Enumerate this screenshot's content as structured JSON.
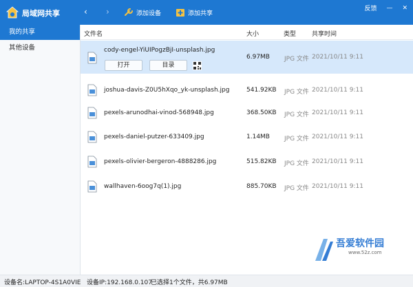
{
  "window": {
    "title": "局域网共享",
    "feedback_label": "反馈",
    "minimize_symbol": "—",
    "close_symbol": "✕",
    "accent_color": "#1e78d2"
  },
  "toolbar": {
    "back_icon": "‹",
    "forward_icon": "›",
    "add_device_label": "添加设备",
    "add_share_label": "添加共享"
  },
  "sidebar": {
    "items": [
      {
        "label": "我的共享",
        "active": true
      },
      {
        "label": "其他设备",
        "active": false
      }
    ]
  },
  "table": {
    "headers": {
      "name": "文件名",
      "size": "大小",
      "type": "类型",
      "time": "共享时间"
    },
    "rows": [
      {
        "name": "cody-engel-YiUIPogzBjI-unsplash.jpg",
        "size": "6.97MB",
        "type": "JPG 文件",
        "time": "2021/10/11 9:11",
        "selected": true
      },
      {
        "name": "joshua-davis-Z0U5hXqo_yk-unsplash.jpg",
        "size": "541.92KB",
        "type": "JPG 文件",
        "time": "2021/10/11 9:11",
        "selected": false
      },
      {
        "name": "pexels-arunodhai-vinod-568948.jpg",
        "size": "368.50KB",
        "type": "JPG 文件",
        "time": "2021/10/11 9:11",
        "selected": false
      },
      {
        "name": "pexels-daniel-putzer-633409.jpg",
        "size": "1.14MB",
        "type": "JPG 文件",
        "time": "2021/10/11 9:11",
        "selected": false
      },
      {
        "name": "pexels-olivier-bergeron-4888286.jpg",
        "size": "515.82KB",
        "type": "JPG 文件",
        "time": "2021/10/11 9:11",
        "selected": false
      },
      {
        "name": "wallhaven-6oog7q(1).jpg",
        "size": "885.70KB",
        "type": "JPG 文件",
        "time": "2021/10/11 9:11",
        "selected": false
      }
    ],
    "selected_actions": {
      "open_label": "打开",
      "folder_label": "目录"
    }
  },
  "status": {
    "device_name": "设备名:LAPTOP-4S1A0VIE",
    "device_ip": "设备IP:192.168.0.107",
    "selection": "已选择1个文件，共6.97MB"
  },
  "watermark": {
    "text": "吾爱软件园",
    "url": "www.52z.com"
  }
}
